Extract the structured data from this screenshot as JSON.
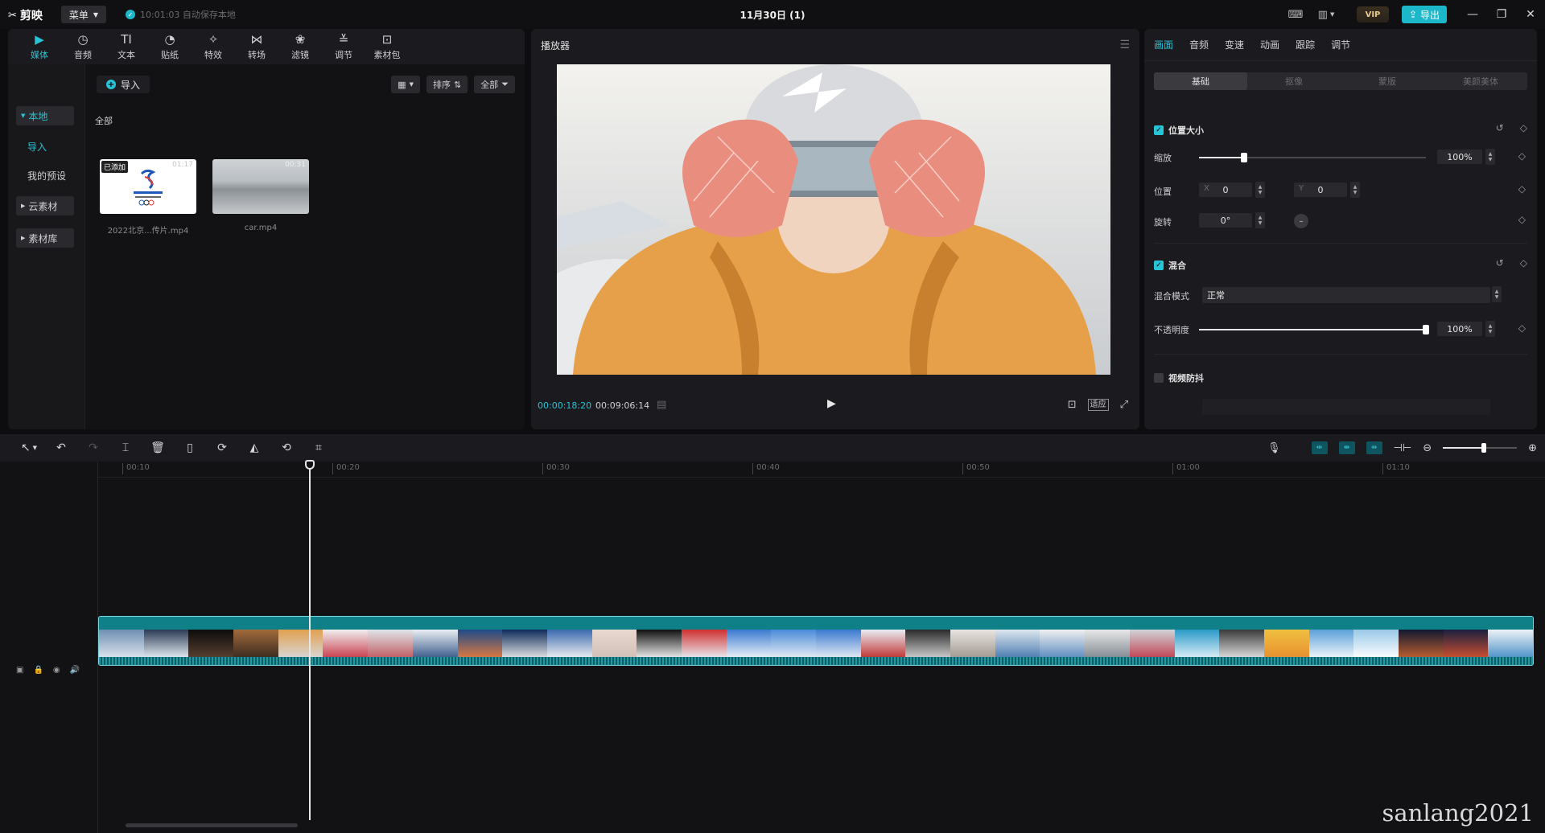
{
  "app": {
    "name": "剪映",
    "menu_label": "菜单",
    "autosave": "10:01:03 自动保存本地",
    "doc_title": "11月30日 (1)",
    "vip_label": "VIP",
    "export_label": "导出"
  },
  "tool_tabs": [
    {
      "label": "媒体",
      "icon": "media-icon"
    },
    {
      "label": "音频",
      "icon": "audio-icon"
    },
    {
      "label": "文本",
      "icon": "text-icon"
    },
    {
      "label": "贴纸",
      "icon": "sticker-icon"
    },
    {
      "label": "特效",
      "icon": "effects-icon"
    },
    {
      "label": "转场",
      "icon": "transition-icon"
    },
    {
      "label": "滤镜",
      "icon": "filter-icon"
    },
    {
      "label": "调节",
      "icon": "adjust-icon"
    },
    {
      "label": "素材包",
      "icon": "package-icon"
    }
  ],
  "media_sidebar": {
    "local": "本地",
    "import": "导入",
    "my_presets": "我的预设",
    "cloud": "云素材",
    "library": "素材库"
  },
  "media_main": {
    "import_label": "导入",
    "sort_label": "排序",
    "filter_label": "全部",
    "all_label": "全部",
    "clips": [
      {
        "name": "2022北京...传片.mp4",
        "tag": "已添加",
        "duration": "01:17"
      },
      {
        "name": "car.mp4",
        "tag": "",
        "duration": "00:31"
      }
    ]
  },
  "player": {
    "title": "播放器",
    "current_time": "00:00:18:20",
    "total_time": "00:09:06:14",
    "fit_label": "适应"
  },
  "inspector": {
    "tabs": [
      "画面",
      "音频",
      "变速",
      "动画",
      "跟踪",
      "调节"
    ],
    "sub_tabs": [
      "基础",
      "抠像",
      "蒙版",
      "美颜美体"
    ],
    "position_size": "位置大小",
    "scale_label": "缩放",
    "scale_value": "100%",
    "scale_fraction": 0.2,
    "position_label": "位置",
    "x_label": "X",
    "x_value": "0",
    "y_label": "Y",
    "y_value": "0",
    "rotate_label": "旋转",
    "rotate_value": "0°",
    "blend_title": "混合",
    "blend_mode_label": "混合模式",
    "blend_mode_value": "正常",
    "opacity_label": "不透明度",
    "opacity_value": "100%",
    "opacity_fraction": 1.0,
    "stabilize_label": "视频防抖"
  },
  "timeline": {
    "ticks": [
      "00:10",
      "00:20",
      "00:30",
      "00:40",
      "00:50",
      "01:00",
      "01:10"
    ]
  },
  "watermark": "sanlang2021",
  "colors": {
    "accent": "#27c3d6",
    "clip_track": "#0c6b73",
    "jacket": "#e7a04a"
  }
}
